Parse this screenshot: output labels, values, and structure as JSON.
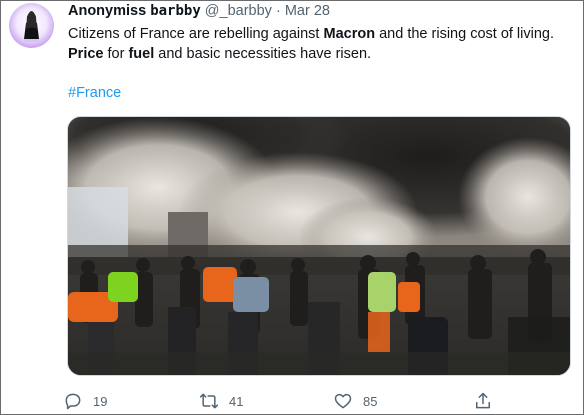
{
  "tweet": {
    "display_name_plain": "Anonymiss ",
    "display_name_styled": "barbby",
    "handle": "@_barbby",
    "separator": "·",
    "time": "Mar 28",
    "text": {
      "line1_part1": "Citizens of France are rebelling against ",
      "line1_bold": "Macron",
      "line1_part2": " and the rising cost of living.",
      "line2_bold1": "Price",
      "line2_part1": " for ",
      "line2_bold2": "fuel",
      "line2_part2": " and basic necessities have risen."
    },
    "hashtag": "#France"
  },
  "actions": {
    "reply_count": "19",
    "retweet_count": "41",
    "like_count": "85",
    "reply_icon": "reply-icon",
    "retweet_icon": "retweet-icon",
    "like_icon": "heart-icon",
    "share_icon": "share-icon"
  },
  "colors": {
    "hashtag": "#1d9bf0",
    "secondary_text": "#536471",
    "primary_text": "#0f1419",
    "avatar_bg": "#caa6ef"
  }
}
